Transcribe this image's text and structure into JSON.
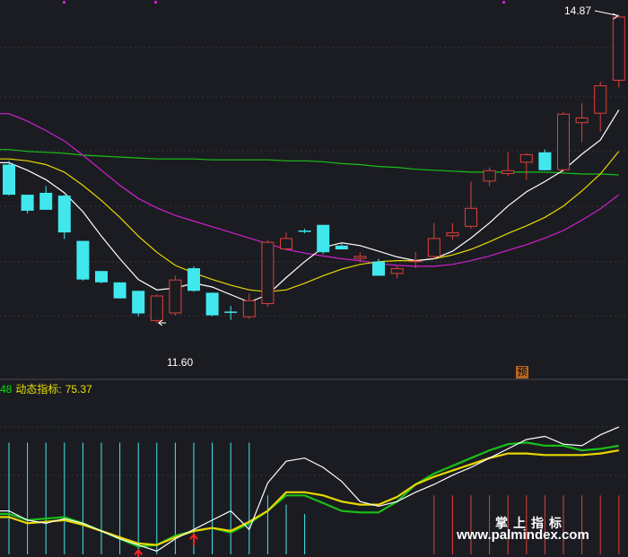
{
  "chart_data": {
    "type": "candlestick",
    "price_panel": {
      "ylim": [
        11.2,
        14.95
      ],
      "high_label": "14.87",
      "low_label": "11.60",
      "pre_badge": "预",
      "colors": {
        "up": "#e0403a",
        "down": "#40e8ee",
        "ma_white": "#ffffff",
        "ma_yellow": "#e8d800",
        "ma_magenta": "#d020d0",
        "ma_green": "#18c018"
      },
      "candles": [
        {
          "o": 13.28,
          "h": 13.32,
          "l": 12.95,
          "c": 12.96
        },
        {
          "o": 12.96,
          "h": 12.96,
          "l": 12.76,
          "c": 12.79
        },
        {
          "o": 12.98,
          "h": 13.05,
          "l": 12.8,
          "c": 12.8
        },
        {
          "o": 12.95,
          "h": 12.96,
          "l": 12.49,
          "c": 12.56
        },
        {
          "o": 12.47,
          "h": 12.47,
          "l": 12.05,
          "c": 12.06
        },
        {
          "o": 12.15,
          "h": 12.15,
          "l": 12.02,
          "c": 12.03
        },
        {
          "o": 12.03,
          "h": 12.03,
          "l": 11.86,
          "c": 11.86
        },
        {
          "o": 11.94,
          "h": 11.94,
          "l": 11.67,
          "c": 11.7
        },
        {
          "o": 11.62,
          "h": 11.9,
          "l": 11.6,
          "c": 11.89
        },
        {
          "o": 11.7,
          "h": 12.1,
          "l": 11.68,
          "c": 12.06
        },
        {
          "o": 12.18,
          "h": 12.2,
          "l": 11.93,
          "c": 11.94
        },
        {
          "o": 11.92,
          "h": 11.92,
          "l": 11.67,
          "c": 11.68
        },
        {
          "o": 11.72,
          "h": 11.78,
          "l": 11.63,
          "c": 11.71
        },
        {
          "o": 11.66,
          "h": 11.91,
          "l": 11.64,
          "c": 11.84
        },
        {
          "o": 11.8,
          "h": 12.48,
          "l": 11.77,
          "c": 12.46
        },
        {
          "o": 12.38,
          "h": 12.56,
          "l": 12.37,
          "c": 12.5
        },
        {
          "o": 12.58,
          "h": 12.6,
          "l": 12.55,
          "c": 12.57
        },
        {
          "o": 12.64,
          "h": 12.64,
          "l": 12.33,
          "c": 12.35
        },
        {
          "o": 12.42,
          "h": 12.45,
          "l": 12.38,
          "c": 12.38
        },
        {
          "o": 12.28,
          "h": 12.35,
          "l": 12.24,
          "c": 12.31
        },
        {
          "o": 12.25,
          "h": 12.28,
          "l": 12.1,
          "c": 12.1
        },
        {
          "o": 12.12,
          "h": 12.2,
          "l": 12.07,
          "c": 12.18
        },
        {
          "o": 12.25,
          "h": 12.35,
          "l": 12.18,
          "c": 12.26
        },
        {
          "o": 12.3,
          "h": 12.66,
          "l": 12.27,
          "c": 12.5
        },
        {
          "o": 12.52,
          "h": 12.66,
          "l": 12.48,
          "c": 12.56
        },
        {
          "o": 12.62,
          "h": 13.1,
          "l": 12.6,
          "c": 12.82
        },
        {
          "o": 13.1,
          "h": 13.25,
          "l": 13.05,
          "c": 13.22
        },
        {
          "o": 13.18,
          "h": 13.41,
          "l": 13.16,
          "c": 13.22
        },
        {
          "o": 13.3,
          "h": 13.4,
          "l": 13.12,
          "c": 13.39
        },
        {
          "o": 13.41,
          "h": 13.44,
          "l": 13.22,
          "c": 13.22
        },
        {
          "o": 13.22,
          "h": 13.84,
          "l": 13.2,
          "c": 13.82
        },
        {
          "o": 13.72,
          "h": 13.93,
          "l": 13.52,
          "c": 13.78
        },
        {
          "o": 13.82,
          "h": 14.16,
          "l": 13.63,
          "c": 14.12
        },
        {
          "o": 14.17,
          "h": 14.87,
          "l": 14.1,
          "c": 14.85
        }
      ],
      "ma_white": [
        13.3,
        13.22,
        13.12,
        12.98,
        12.78,
        12.52,
        12.28,
        12.06,
        11.95,
        11.97,
        12.02,
        11.98,
        11.9,
        11.82,
        11.9,
        12.08,
        12.25,
        12.4,
        12.45,
        12.42,
        12.36,
        12.3,
        12.26,
        12.28,
        12.36,
        12.5,
        12.66,
        12.84,
        12.99,
        13.1,
        13.22,
        13.39,
        13.54,
        13.86
      ],
      "ma_yellow": [
        13.34,
        13.32,
        13.28,
        13.2,
        13.06,
        12.9,
        12.72,
        12.52,
        12.35,
        12.21,
        12.13,
        12.06,
        12.0,
        11.95,
        11.93,
        11.95,
        12.02,
        12.1,
        12.17,
        12.22,
        12.25,
        12.26,
        12.26,
        12.28,
        12.32,
        12.38,
        12.46,
        12.55,
        12.63,
        12.72,
        12.84,
        13.0,
        13.18,
        13.42
      ],
      "ma_magenta": [
        13.82,
        13.74,
        13.64,
        13.53,
        13.38,
        13.22,
        13.06,
        12.92,
        12.82,
        12.74,
        12.68,
        12.62,
        12.56,
        12.5,
        12.44,
        12.38,
        12.34,
        12.31,
        12.28,
        12.26,
        12.23,
        12.21,
        12.2,
        12.2,
        12.22,
        12.26,
        12.31,
        12.37,
        12.43,
        12.5,
        12.58,
        12.69,
        12.81,
        12.96
      ],
      "ma_green": [
        13.44,
        13.42,
        13.41,
        13.4,
        13.38,
        13.37,
        13.36,
        13.35,
        13.34,
        13.34,
        13.34,
        13.33,
        13.33,
        13.33,
        13.33,
        13.32,
        13.32,
        13.31,
        13.29,
        13.28,
        13.26,
        13.25,
        13.23,
        13.22,
        13.21,
        13.2,
        13.2,
        13.2,
        13.2,
        13.2,
        13.19,
        13.18,
        13.18,
        13.17
      ]
    },
    "indicator_panel": {
      "prefix": "48",
      "name": "动态指标:",
      "value": "75.37",
      "ylim": [
        0,
        100
      ],
      "signal_bars": [
        72,
        72,
        72,
        72,
        72,
        72,
        72,
        72,
        72,
        72,
        72,
        72,
        72,
        72,
        38,
        32,
        26,
        0,
        0,
        0,
        0,
        0,
        0,
        38,
        38,
        38,
        38,
        38,
        38,
        38,
        38,
        38,
        38,
        38
      ],
      "series": [
        {
          "color": "#ffffff",
          "values": [
            28,
            22,
            20,
            23,
            20,
            15,
            10,
            6,
            2,
            10,
            16,
            22,
            28,
            16,
            46,
            60,
            62,
            56,
            47,
            34,
            31,
            34,
            40,
            45,
            51,
            56,
            62,
            68,
            74,
            76,
            71,
            70,
            77,
            82
          ]
        },
        {
          "color": "#e8d800",
          "values": [
            24,
            20,
            21,
            22,
            19,
            15,
            11,
            7,
            6,
            11,
            15,
            17,
            15,
            21,
            28,
            40,
            40,
            38,
            34,
            32,
            32,
            37,
            45,
            50,
            54,
            58,
            62,
            65,
            65,
            64,
            64,
            64,
            65,
            67
          ]
        },
        {
          "color": "#18c018",
          "values": [
            26,
            22,
            23,
            24,
            20,
            15,
            10,
            5,
            6,
            12,
            15,
            17,
            14,
            20,
            28,
            38,
            38,
            33,
            28,
            27,
            27,
            34,
            45,
            52,
            57,
            62,
            67,
            71,
            72,
            70,
            70,
            67,
            68,
            70
          ]
        }
      ],
      "arrows_at": [
        7,
        10
      ]
    },
    "watermark_cn": "掌上指标",
    "watermark_url": "www.palmindex.com"
  }
}
